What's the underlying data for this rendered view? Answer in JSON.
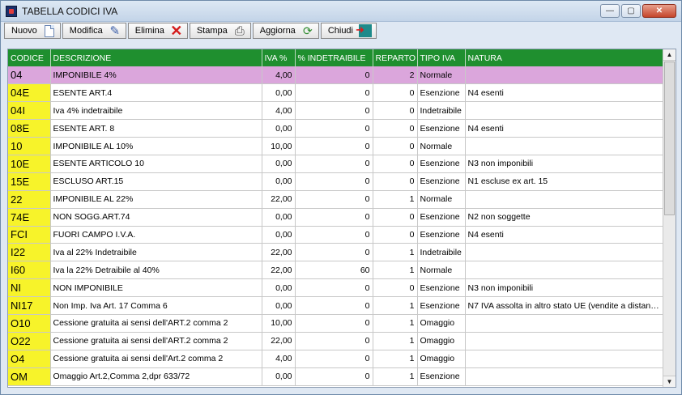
{
  "window": {
    "title": "TABELLA CODICI IVA",
    "minimize": "—",
    "maximize": "▢",
    "close": "✕"
  },
  "toolbar": {
    "new_label": "Nuovo",
    "edit_label": "Modifica",
    "delete_label": "Elimina",
    "print_label": "Stampa",
    "update_label": "Aggiorna",
    "close_label": "Chiudi",
    "icons": {
      "new": "document-icon",
      "edit": "pencil-icon",
      "delete": "red-x-icon",
      "print": "printer-icon",
      "update": "refresh-icon",
      "close": "exit-door-icon"
    }
  },
  "table": {
    "headers": [
      "CODICE",
      "DESCRIZIONE",
      "IVA %",
      "% INDETRAIBILE",
      "REPARTO",
      "TIPO IVA",
      "NATURA"
    ],
    "rows": [
      {
        "codice": "04",
        "descrizione": "IMPONIBILE 4%",
        "iva": "4,00",
        "indetraibile": "0",
        "reparto": "2",
        "tipo": "Normale",
        "natura": ""
      },
      {
        "codice": "04E",
        "descrizione": "ESENTE ART.4",
        "iva": "0,00",
        "indetraibile": "0",
        "reparto": "0",
        "tipo": "Esenzione",
        "natura": "N4  esenti"
      },
      {
        "codice": "04I",
        "descrizione": "Iva 4% indetraibile",
        "iva": "4,00",
        "indetraibile": "0",
        "reparto": "0",
        "tipo": "Indetraibile",
        "natura": ""
      },
      {
        "codice": "08E",
        "descrizione": "ESENTE ART. 8",
        "iva": "0,00",
        "indetraibile": "0",
        "reparto": "0",
        "tipo": "Esenzione",
        "natura": "N4  esenti"
      },
      {
        "codice": "10",
        "descrizione": "IMPONIBILE AL 10%",
        "iva": "10,00",
        "indetraibile": "0",
        "reparto": "0",
        "tipo": "Normale",
        "natura": ""
      },
      {
        "codice": "10E",
        "descrizione": "ESENTE ARTICOLO 10",
        "iva": "0,00",
        "indetraibile": "0",
        "reparto": "0",
        "tipo": "Esenzione",
        "natura": "N3  non imponibili"
      },
      {
        "codice": "15E",
        "descrizione": "ESCLUSO ART.15",
        "iva": "0,00",
        "indetraibile": "0",
        "reparto": "0",
        "tipo": "Esenzione",
        "natura": "N1  escluse ex art. 15"
      },
      {
        "codice": "22",
        "descrizione": "IMPONIBILE AL 22%",
        "iva": "22,00",
        "indetraibile": "0",
        "reparto": "1",
        "tipo": "Normale",
        "natura": ""
      },
      {
        "codice": "74E",
        "descrizione": "NON SOGG.ART.74",
        "iva": "0,00",
        "indetraibile": "0",
        "reparto": "0",
        "tipo": "Esenzione",
        "natura": "N2  non soggette"
      },
      {
        "codice": "FCI",
        "descrizione": "FUORI CAMPO I.V.A.",
        "iva": "0,00",
        "indetraibile": "0",
        "reparto": "0",
        "tipo": "Esenzione",
        "natura": "N4  esenti"
      },
      {
        "codice": "I22",
        "descrizione": "Iva al 22% Indetraibile",
        "iva": "22,00",
        "indetraibile": "0",
        "reparto": "1",
        "tipo": "Indetraibile",
        "natura": ""
      },
      {
        "codice": "I60",
        "descrizione": "Iva la 22% Detraibile al 40%",
        "iva": "22,00",
        "indetraibile": "60",
        "reparto": "1",
        "tipo": "Normale",
        "natura": ""
      },
      {
        "codice": "NI",
        "descrizione": "NON IMPONIBILE",
        "iva": "0,00",
        "indetraibile": "0",
        "reparto": "0",
        "tipo": "Esenzione",
        "natura": "N3  non imponibili"
      },
      {
        "codice": "NI17",
        "descrizione": "Non Imp. Iva Art. 17 Comma 6",
        "iva": "0,00",
        "indetraibile": "0",
        "reparto": "1",
        "tipo": "Esenzione",
        "natura": "N7  IVA assolta in altro stato UE (vendite a distanz..."
      },
      {
        "codice": "O10",
        "descrizione": "Cessione gratuita ai sensi dell'ART.2 comma 2",
        "iva": "10,00",
        "indetraibile": "0",
        "reparto": "1",
        "tipo": "Omaggio",
        "natura": ""
      },
      {
        "codice": "O22",
        "descrizione": "Cessione gratuita ai sensi dell'ART.2 comma 2",
        "iva": "22,00",
        "indetraibile": "0",
        "reparto": "1",
        "tipo": "Omaggio",
        "natura": ""
      },
      {
        "codice": "O4",
        "descrizione": "Cessione gratuita ai sensi dell'Art.2 comma 2",
        "iva": "4,00",
        "indetraibile": "0",
        "reparto": "1",
        "tipo": "Omaggio",
        "natura": ""
      },
      {
        "codice": "OM",
        "descrizione": "Omaggio Art.2,Comma 2,dpr 633/72",
        "iva": "0,00",
        "indetraibile": "0",
        "reparto": "1",
        "tipo": "Esenzione",
        "natura": ""
      }
    ],
    "selected_index": 0
  },
  "colors": {
    "header_bg": "#1f8f2f",
    "code_bg": "#f7f32a",
    "selected_bg": "#dba6dc"
  },
  "scrollbar": {
    "up": "▲",
    "down": "▼"
  }
}
